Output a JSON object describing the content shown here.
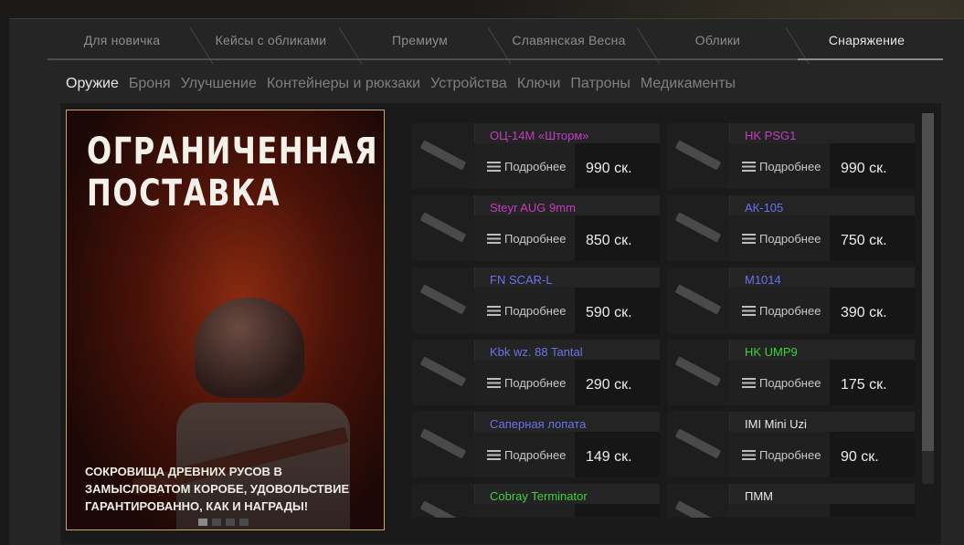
{
  "tabs": [
    {
      "label": "Для новичка"
    },
    {
      "label": "Кейсы с обликами"
    },
    {
      "label": "Премиум"
    },
    {
      "label": "Славянская Весна"
    },
    {
      "label": "Облики"
    },
    {
      "label": "Снаряжение",
      "active": true
    }
  ],
  "subcategories": [
    {
      "label": "Оружие",
      "active": true
    },
    {
      "label": "Броня"
    },
    {
      "label": "Улучшение"
    },
    {
      "label": "Контейнеры и рюкзаки"
    },
    {
      "label": "Устройства"
    },
    {
      "label": "Ключи"
    },
    {
      "label": "Патроны"
    },
    {
      "label": "Медикаменты"
    }
  ],
  "promo": {
    "title_line1": "ОГРАНИЧЕННАЯ",
    "title_line2": "ПОСТАВКА",
    "description": "СОКРОВИЩА ДРЕВНИХ РУСОВ В ЗАМЫСЛОВАТОМ КОРОБЕ, УДОВОЛЬСТВИЕ ГАРАНТИРОВАННО, КАК И НАГРАДЫ!",
    "slides": 4,
    "active_slide": 1
  },
  "details_label": "Подробнее",
  "items": [
    {
      "name": "ОЦ-14М «Шторм»",
      "price": "990 ск.",
      "color": "#c33dc0"
    },
    {
      "name": "HK PSG1",
      "price": "990 ск.",
      "color": "#c33dc0"
    },
    {
      "name": "Steyr AUG 9mm",
      "price": "850 ск.",
      "color": "#c33dc0"
    },
    {
      "name": "АК-105",
      "price": "750 ск.",
      "color": "#6a72ee"
    },
    {
      "name": "FN SCAR-L",
      "price": "590 ск.",
      "color": "#6a72ee"
    },
    {
      "name": "M1014",
      "price": "390 ск.",
      "color": "#6a72ee"
    },
    {
      "name": "Kbk wz. 88 Tantal",
      "price": "290 ск.",
      "color": "#6a72ee"
    },
    {
      "name": "HK UMP9",
      "price": "175 ск.",
      "color": "#3fd03f"
    },
    {
      "name": "Саперная лопата",
      "price": "149 ск.",
      "color": "#6a72ee"
    },
    {
      "name": "IMI Mini Uzi",
      "price": "90 ск.",
      "color": "#e8e8e8"
    },
    {
      "name": "Cobray Terminator",
      "price": "",
      "color": "#3fd03f"
    },
    {
      "name": "ПММ",
      "price": "",
      "color": "#e8e8e8"
    }
  ]
}
